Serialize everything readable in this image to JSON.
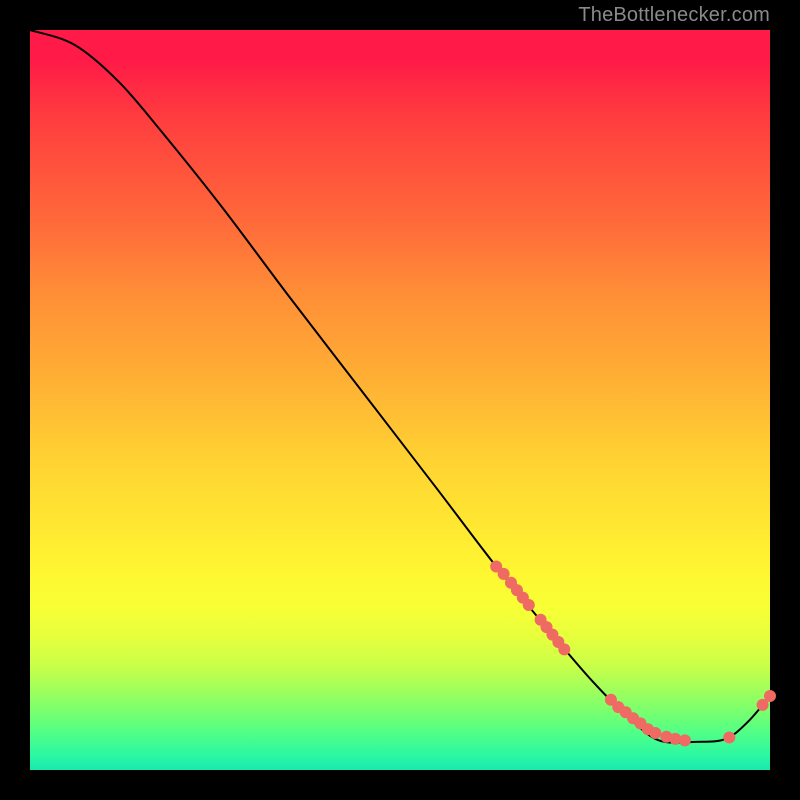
{
  "watermark": "TheBottlenecker.com",
  "chart_data": {
    "type": "line",
    "title": "",
    "xlabel": "",
    "ylabel": "",
    "xlim": [
      0,
      100
    ],
    "ylim": [
      0,
      100
    ],
    "curve": [
      {
        "x": 0.0,
        "y": 100.0
      },
      {
        "x": 6.0,
        "y": 98.0
      },
      {
        "x": 12.0,
        "y": 93.0
      },
      {
        "x": 18.0,
        "y": 86.0
      },
      {
        "x": 26.0,
        "y": 76.0
      },
      {
        "x": 35.0,
        "y": 64.0
      },
      {
        "x": 45.0,
        "y": 51.0
      },
      {
        "x": 55.0,
        "y": 38.0
      },
      {
        "x": 63.0,
        "y": 27.5
      },
      {
        "x": 70.0,
        "y": 19.0
      },
      {
        "x": 76.0,
        "y": 12.0
      },
      {
        "x": 81.0,
        "y": 7.0
      },
      {
        "x": 85.0,
        "y": 4.0
      },
      {
        "x": 90.0,
        "y": 3.8
      },
      {
        "x": 94.0,
        "y": 4.2
      },
      {
        "x": 97.0,
        "y": 6.5
      },
      {
        "x": 100.0,
        "y": 10.0
      }
    ],
    "marker_clusters": [
      {
        "x": 63.0,
        "y": 27.5
      },
      {
        "x": 64.0,
        "y": 26.5
      },
      {
        "x": 65.0,
        "y": 25.3
      },
      {
        "x": 65.8,
        "y": 24.3
      },
      {
        "x": 66.6,
        "y": 23.3
      },
      {
        "x": 67.4,
        "y": 22.3
      },
      {
        "x": 69.0,
        "y": 20.3
      },
      {
        "x": 69.8,
        "y": 19.3
      },
      {
        "x": 70.6,
        "y": 18.3
      },
      {
        "x": 71.4,
        "y": 17.3
      },
      {
        "x": 72.2,
        "y": 16.3
      },
      {
        "x": 78.5,
        "y": 9.5
      },
      {
        "x": 79.5,
        "y": 8.5
      },
      {
        "x": 80.5,
        "y": 7.8
      },
      {
        "x": 81.5,
        "y": 7.0
      },
      {
        "x": 82.5,
        "y": 6.3
      },
      {
        "x": 83.5,
        "y": 5.5
      },
      {
        "x": 84.5,
        "y": 5.0
      },
      {
        "x": 86.0,
        "y": 4.5
      },
      {
        "x": 87.2,
        "y": 4.2
      },
      {
        "x": 88.5,
        "y": 4.0
      },
      {
        "x": 94.5,
        "y": 4.4
      },
      {
        "x": 99.0,
        "y": 8.8
      },
      {
        "x": 100.0,
        "y": 10.0
      }
    ],
    "marker_color": "#ee6a62",
    "curve_color": "#000000"
  }
}
